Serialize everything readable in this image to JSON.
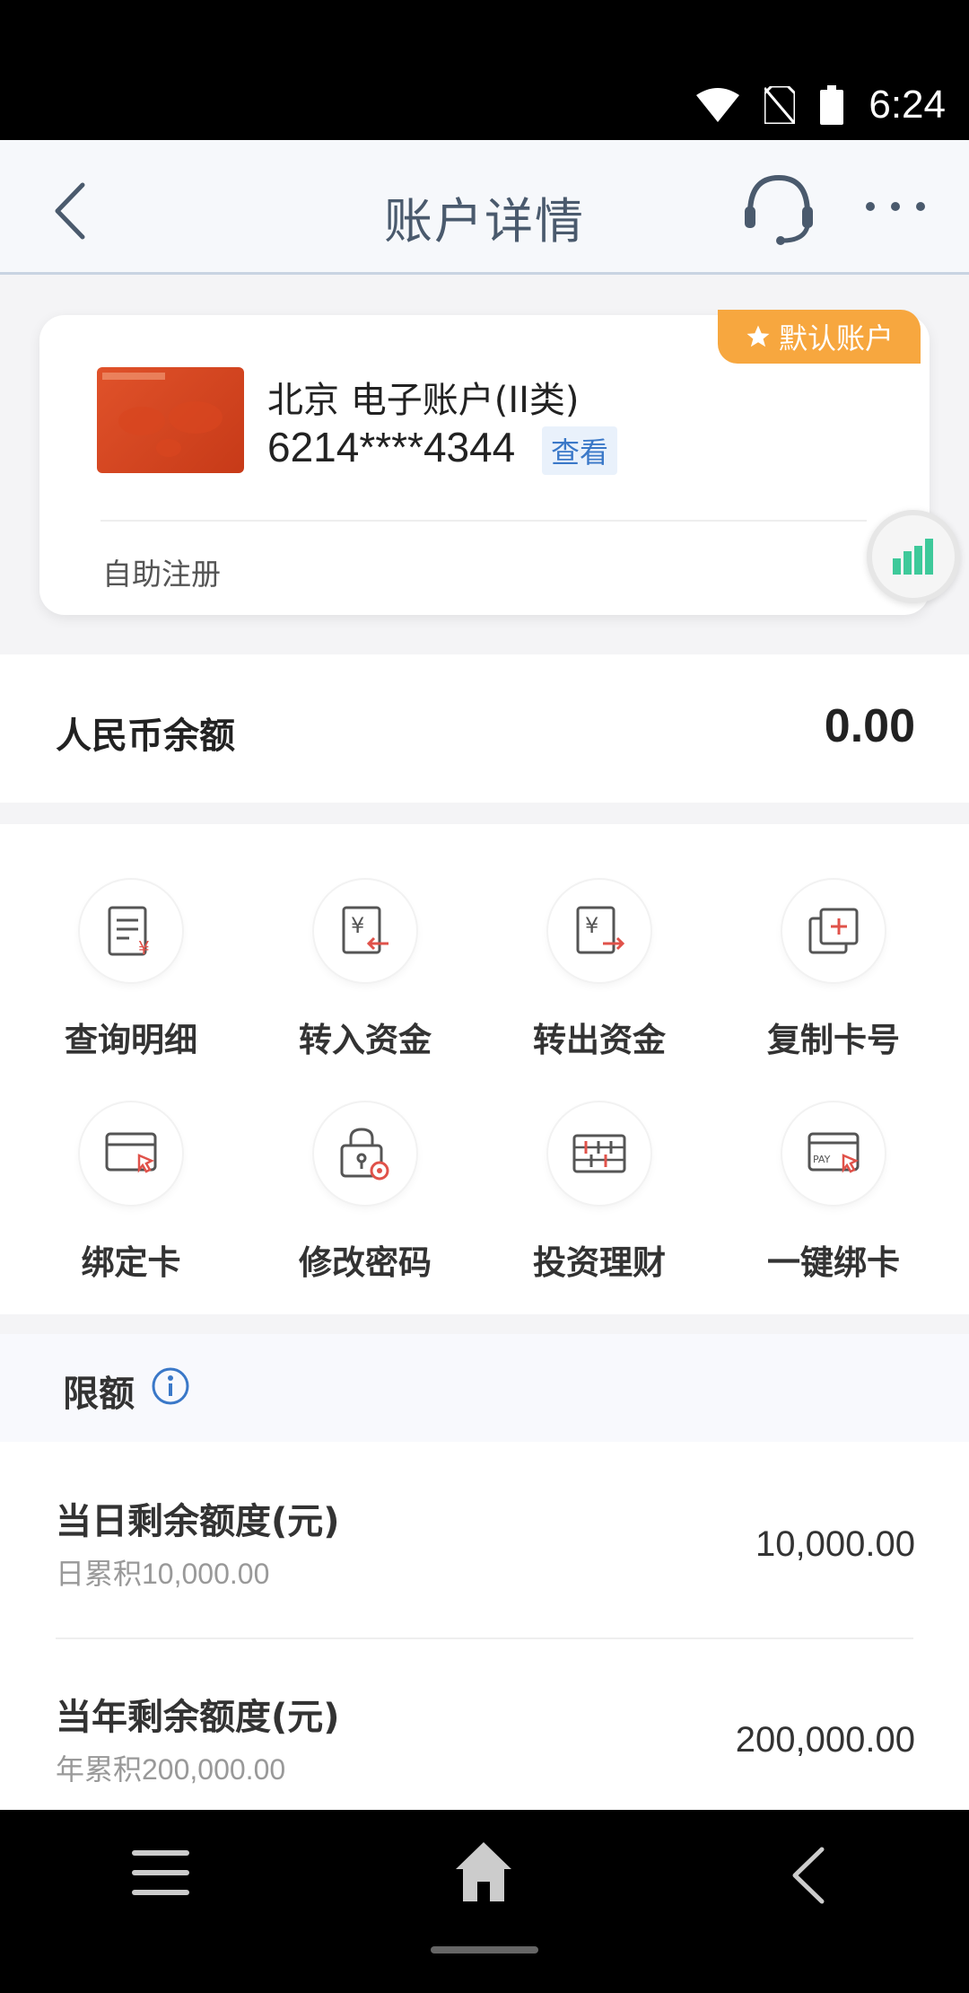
{
  "status_bar": {
    "time": "6:24"
  },
  "nav": {
    "title": "账户详情"
  },
  "account": {
    "default_badge": "默认账户",
    "name": "北京 电子账户(II类)",
    "number": "6214****4344",
    "view_label": "查看",
    "self_register": "自助注册"
  },
  "balance": {
    "label": "人民币余额",
    "value": "0.00"
  },
  "actions": [
    {
      "label": "查询明细",
      "icon": "receipt-yen-icon"
    },
    {
      "label": "转入资金",
      "icon": "transfer-in-icon"
    },
    {
      "label": "转出资金",
      "icon": "transfer-out-icon"
    },
    {
      "label": "复制卡号",
      "icon": "copy-icon"
    },
    {
      "label": "绑定卡",
      "icon": "bind-card-icon"
    },
    {
      "label": "修改密码",
      "icon": "lock-gear-icon"
    },
    {
      "label": "投资理财",
      "icon": "abacus-icon"
    },
    {
      "label": "一键绑卡",
      "icon": "pay-card-icon"
    }
  ],
  "limits": {
    "title": "限额",
    "rows": [
      {
        "label": "当日剩余额度(元)",
        "sub": "日累积10,000.00",
        "value": "10,000.00"
      },
      {
        "label": "当年剩余额度(元)",
        "sub": "年累积200,000.00",
        "value": "200,000.00"
      }
    ]
  },
  "colors": {
    "accent_orange": "#f7a73f",
    "link_blue": "#3a78c8",
    "icon_red": "#e0524a",
    "chart_green": "#3ec99a"
  }
}
